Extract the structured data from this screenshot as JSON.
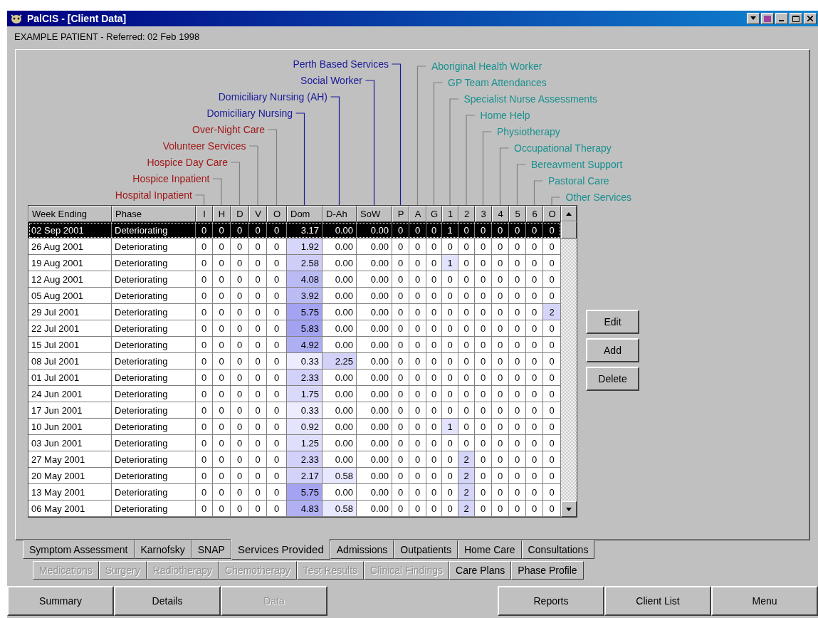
{
  "window": {
    "title": "PalCIS - [Client Data]"
  },
  "patient_line": "EXAMPLE PATIENT - Referred: 02 Feb 1998",
  "table": {
    "columns": [
      {
        "label": "Week Ending",
        "kind": "text"
      },
      {
        "label": "Phase",
        "kind": "text"
      },
      {
        "label": "I",
        "kind": "num",
        "legend": "Hospital Inpatient",
        "color": "#a01818"
      },
      {
        "label": "H",
        "kind": "num",
        "legend": "Hospice Inpatient",
        "color": "#a01818"
      },
      {
        "label": "D",
        "kind": "num",
        "legend": "Hospice Day Care",
        "color": "#a01818"
      },
      {
        "label": "V",
        "kind": "num",
        "legend": "Volunteer Services",
        "color": "#a01818"
      },
      {
        "label": "O",
        "kind": "num",
        "legend": "Over-Night Care",
        "color": "#a01818"
      },
      {
        "label": "Dom",
        "kind": "num",
        "legend": "Domiciliary Nursing",
        "color": "#1a1a9a"
      },
      {
        "label": "D-Ah",
        "kind": "num",
        "legend": "Domiciliary Nursing (AH)",
        "color": "#1a1a9a"
      },
      {
        "label": "SoW",
        "kind": "num",
        "legend": "Social Worker",
        "color": "#1a1a9a"
      },
      {
        "label": "P",
        "kind": "num",
        "legend": "Perth Based Services",
        "color": "#1a1a9a"
      },
      {
        "label": "A",
        "kind": "num",
        "legend": "Aboriginal Health Worker",
        "color": "#1a9090"
      },
      {
        "label": "G",
        "kind": "num",
        "legend": "GP Team Attendances",
        "color": "#1a9090"
      },
      {
        "label": "1",
        "kind": "num",
        "legend": "Specialist Nurse Assessments",
        "color": "#1a9090"
      },
      {
        "label": "2",
        "kind": "num",
        "legend": "Home Help",
        "color": "#1a9090"
      },
      {
        "label": "3",
        "kind": "num",
        "legend": "Physiotherapy",
        "color": "#1a9090"
      },
      {
        "label": "4",
        "kind": "num",
        "legend": "Occupational Therapy",
        "color": "#1a9090"
      },
      {
        "label": "5",
        "kind": "num",
        "legend": "Bereavment Support",
        "color": "#1a9090"
      },
      {
        "label": "6",
        "kind": "num",
        "legend": "Pastoral Care",
        "color": "#1a9090"
      },
      {
        "label": "O",
        "kind": "num",
        "legend": "Other Services",
        "color": "#1a9090"
      }
    ],
    "rows": [
      {
        "selected": true,
        "cells": [
          "02 Sep 2001",
          "Deteriorating",
          "0",
          "0",
          "0",
          "0",
          "0",
          "3.17",
          "0.00",
          "0.00",
          "0",
          "0",
          "0",
          "1",
          "0",
          "0",
          "0",
          "0",
          "0",
          "0"
        ]
      },
      {
        "selected": false,
        "cells": [
          "26 Aug 2001",
          "Deteriorating",
          "0",
          "0",
          "0",
          "0",
          "0",
          "1.92",
          "0.00",
          "0.00",
          "0",
          "0",
          "0",
          "0",
          "0",
          "0",
          "0",
          "0",
          "0",
          "0"
        ]
      },
      {
        "selected": false,
        "cells": [
          "19 Aug 2001",
          "Deteriorating",
          "0",
          "0",
          "0",
          "0",
          "0",
          "2.58",
          "0.00",
          "0.00",
          "0",
          "0",
          "0",
          "1",
          "0",
          "0",
          "0",
          "0",
          "0",
          "0"
        ]
      },
      {
        "selected": false,
        "cells": [
          "12 Aug 2001",
          "Deteriorating",
          "0",
          "0",
          "0",
          "0",
          "0",
          "4.08",
          "0.00",
          "0.00",
          "0",
          "0",
          "0",
          "0",
          "0",
          "0",
          "0",
          "0",
          "0",
          "0"
        ]
      },
      {
        "selected": false,
        "cells": [
          "05 Aug 2001",
          "Deteriorating",
          "0",
          "0",
          "0",
          "0",
          "0",
          "3.92",
          "0.00",
          "0.00",
          "0",
          "0",
          "0",
          "0",
          "0",
          "0",
          "0",
          "0",
          "0",
          "0"
        ]
      },
      {
        "selected": false,
        "cells": [
          "29 Jul 2001",
          "Deteriorating",
          "0",
          "0",
          "0",
          "0",
          "0",
          "5.75",
          "0.00",
          "0.00",
          "0",
          "0",
          "0",
          "0",
          "0",
          "0",
          "0",
          "0",
          "0",
          "2"
        ]
      },
      {
        "selected": false,
        "cells": [
          "22 Jul 2001",
          "Deteriorating",
          "0",
          "0",
          "0",
          "0",
          "0",
          "5.83",
          "0.00",
          "0.00",
          "0",
          "0",
          "0",
          "0",
          "0",
          "0",
          "0",
          "0",
          "0",
          "0"
        ]
      },
      {
        "selected": false,
        "cells": [
          "15 Jul 2001",
          "Deteriorating",
          "0",
          "0",
          "0",
          "0",
          "0",
          "4.92",
          "0.00",
          "0.00",
          "0",
          "0",
          "0",
          "0",
          "0",
          "0",
          "0",
          "0",
          "0",
          "0"
        ]
      },
      {
        "selected": false,
        "cells": [
          "08 Jul 2001",
          "Deteriorating",
          "0",
          "0",
          "0",
          "0",
          "0",
          "0.33",
          "2.25",
          "0.00",
          "0",
          "0",
          "0",
          "0",
          "0",
          "0",
          "0",
          "0",
          "0",
          "0"
        ]
      },
      {
        "selected": false,
        "cells": [
          "01 Jul 2001",
          "Deteriorating",
          "0",
          "0",
          "0",
          "0",
          "0",
          "2.33",
          "0.00",
          "0.00",
          "0",
          "0",
          "0",
          "0",
          "0",
          "0",
          "0",
          "0",
          "0",
          "0"
        ]
      },
      {
        "selected": false,
        "cells": [
          "24 Jun 2001",
          "Deteriorating",
          "0",
          "0",
          "0",
          "0",
          "0",
          "1.75",
          "0.00",
          "0.00",
          "0",
          "0",
          "0",
          "0",
          "0",
          "0",
          "0",
          "0",
          "0",
          "0"
        ]
      },
      {
        "selected": false,
        "cells": [
          "17 Jun 2001",
          "Deteriorating",
          "0",
          "0",
          "0",
          "0",
          "0",
          "0.33",
          "0.00",
          "0.00",
          "0",
          "0",
          "0",
          "0",
          "0",
          "0",
          "0",
          "0",
          "0",
          "0"
        ]
      },
      {
        "selected": false,
        "cells": [
          "10 Jun 2001",
          "Deteriorating",
          "0",
          "0",
          "0",
          "0",
          "0",
          "0.92",
          "0.00",
          "0.00",
          "0",
          "0",
          "0",
          "1",
          "0",
          "0",
          "0",
          "0",
          "0",
          "0"
        ]
      },
      {
        "selected": false,
        "cells": [
          "03 Jun 2001",
          "Deteriorating",
          "0",
          "0",
          "0",
          "0",
          "0",
          "1.25",
          "0.00",
          "0.00",
          "0",
          "0",
          "0",
          "0",
          "0",
          "0",
          "0",
          "0",
          "0",
          "0"
        ]
      },
      {
        "selected": false,
        "cells": [
          "27 May 2001",
          "Deteriorating",
          "0",
          "0",
          "0",
          "0",
          "0",
          "2.33",
          "0.00",
          "0.00",
          "0",
          "0",
          "0",
          "0",
          "2",
          "0",
          "0",
          "0",
          "0",
          "0"
        ]
      },
      {
        "selected": false,
        "cells": [
          "20 May 2001",
          "Deteriorating",
          "0",
          "0",
          "0",
          "0",
          "0",
          "2.17",
          "0.58",
          "0.00",
          "0",
          "0",
          "0",
          "0",
          "2",
          "0",
          "0",
          "0",
          "0",
          "0"
        ]
      },
      {
        "selected": false,
        "cells": [
          "13 May 2001",
          "Deteriorating",
          "0",
          "0",
          "0",
          "0",
          "0",
          "5.75",
          "0.00",
          "0.00",
          "0",
          "0",
          "0",
          "0",
          "2",
          "0",
          "0",
          "0",
          "0",
          "0"
        ]
      },
      {
        "selected": false,
        "cells": [
          "06 May 2001",
          "Deteriorating",
          "0",
          "0",
          "0",
          "0",
          "0",
          "4.83",
          "0.58",
          "0.00",
          "0",
          "0",
          "0",
          "0",
          "2",
          "0",
          "0",
          "0",
          "0",
          "0"
        ]
      }
    ]
  },
  "side_buttons": [
    "Edit",
    "Add",
    "Delete"
  ],
  "tabs_row_1": [
    {
      "label": "Symptom Assessment",
      "selected": false
    },
    {
      "label": "Karnofsky",
      "selected": false
    },
    {
      "label": "SNAP",
      "selected": false
    },
    {
      "label": "Services Provided",
      "selected": true
    },
    {
      "label": "Admissions",
      "selected": false
    },
    {
      "label": "Outpatients",
      "selected": false
    },
    {
      "label": "Home Care",
      "selected": false
    },
    {
      "label": "Consultations",
      "selected": false
    }
  ],
  "tabs_row_2": [
    {
      "label": "Medications",
      "disabled": true
    },
    {
      "label": "Surgery",
      "disabled": true
    },
    {
      "label": "Radiotherapy",
      "disabled": true
    },
    {
      "label": "Chemotherapy",
      "disabled": true
    },
    {
      "label": "Test Results",
      "disabled": true
    },
    {
      "label": "Clinical Findings",
      "disabled": true
    },
    {
      "label": "Care Plans",
      "disabled": false
    },
    {
      "label": "Phase Profile",
      "disabled": false
    }
  ],
  "nav_left": [
    {
      "label": "Summary",
      "disabled": false
    },
    {
      "label": "Details",
      "disabled": false
    },
    {
      "label": "Data",
      "disabled": true
    }
  ],
  "nav_right": [
    {
      "label": "Reports",
      "disabled": false
    },
    {
      "label": "Client List",
      "disabled": false
    },
    {
      "label": "Menu",
      "disabled": false
    }
  ]
}
